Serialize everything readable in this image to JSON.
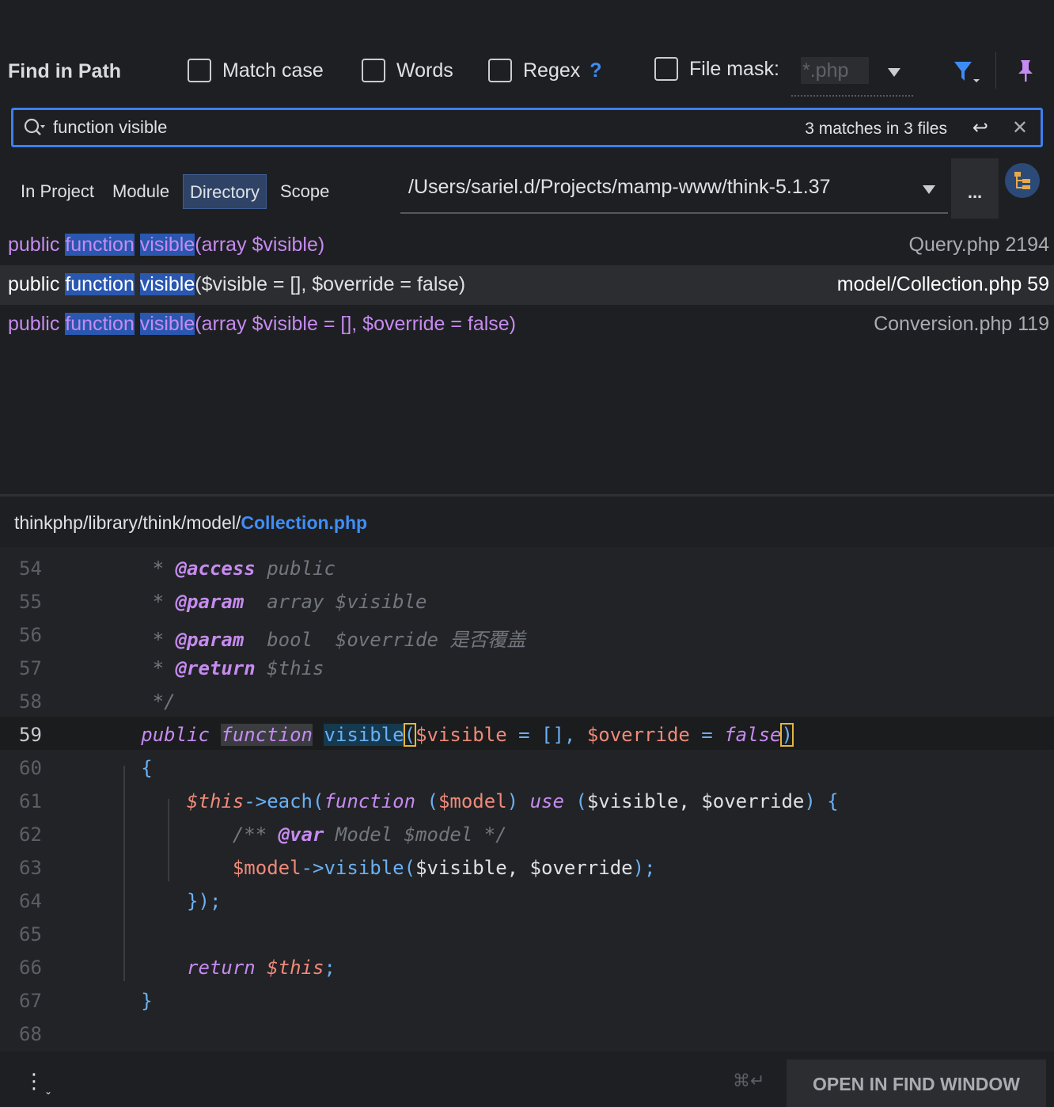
{
  "header": {
    "title": "Find in Path",
    "match_case": "Match case",
    "words": "Words",
    "regex": "Regex",
    "regex_help": "?",
    "file_mask_label": "File mask:",
    "file_mask_value": "*.php"
  },
  "search": {
    "query": "function visible",
    "count": "3 matches in 3 files"
  },
  "scope": {
    "tabs": [
      "In Project",
      "Module",
      "Directory",
      "Scope"
    ],
    "active": "Directory",
    "path": "/Users/sariel.d/Projects/mamp-www/think-5.1.37",
    "more_label": "..."
  },
  "results": [
    {
      "kw": "public",
      "m1": "function",
      "m2": "visible",
      "rest": "(array $visible)",
      "file": "Query.php 2194"
    },
    {
      "kw": "public",
      "m1": "function",
      "m2": "visible",
      "rest": "($visible = [], $override = false)",
      "file": "model/Collection.php 59"
    },
    {
      "kw": "public",
      "m1": "function",
      "m2": "visible",
      "rest": "(array $visible = [], $override = false)",
      "file": "Conversion.php 119"
    }
  ],
  "preview": {
    "path_prefix": "thinkphp/library/think/model/",
    "file_name": "Collection.php",
    "line_numbers": [
      "54",
      "55",
      "56",
      "57",
      "58",
      "59",
      "60",
      "61",
      "62",
      "63",
      "64",
      "65",
      "66",
      "67",
      "68"
    ]
  },
  "code": {
    "l54": [
      "* ",
      "@access",
      " public"
    ],
    "l55": [
      "* ",
      "@param",
      "  array $visible"
    ],
    "l56": [
      "* ",
      "@param",
      "  bool  $override 是否覆盖"
    ],
    "l57": [
      "* ",
      "@return",
      " $this"
    ],
    "l58": "*/",
    "l59": [
      "public",
      "function",
      "visible",
      "(",
      "$visible",
      " = [], ",
      "$override",
      " = ",
      "false",
      ")"
    ],
    "l60": "{",
    "l61": [
      "$this",
      "->",
      "each",
      "(",
      "function",
      " (",
      "$model",
      ") ",
      "use",
      " (",
      "$visible, $override",
      ") {"
    ],
    "l62": [
      "/** ",
      "@var",
      " Model $model */"
    ],
    "l63": [
      "$model",
      "->",
      "visible",
      "(",
      "$visible, $override",
      ");"
    ],
    "l64": "});",
    "l66": [
      "return",
      " $this",
      ";"
    ],
    "l67": "}"
  },
  "footer": {
    "shortcut": "⌘↵",
    "open_button": "OPEN IN FIND WINDOW"
  },
  "colors": {
    "accent": "#3d7ff0",
    "keyword": "#c68bf0",
    "variable": "#ef8a7a",
    "function": "#6ab0f3",
    "match_highlight": "#2a57b0"
  }
}
